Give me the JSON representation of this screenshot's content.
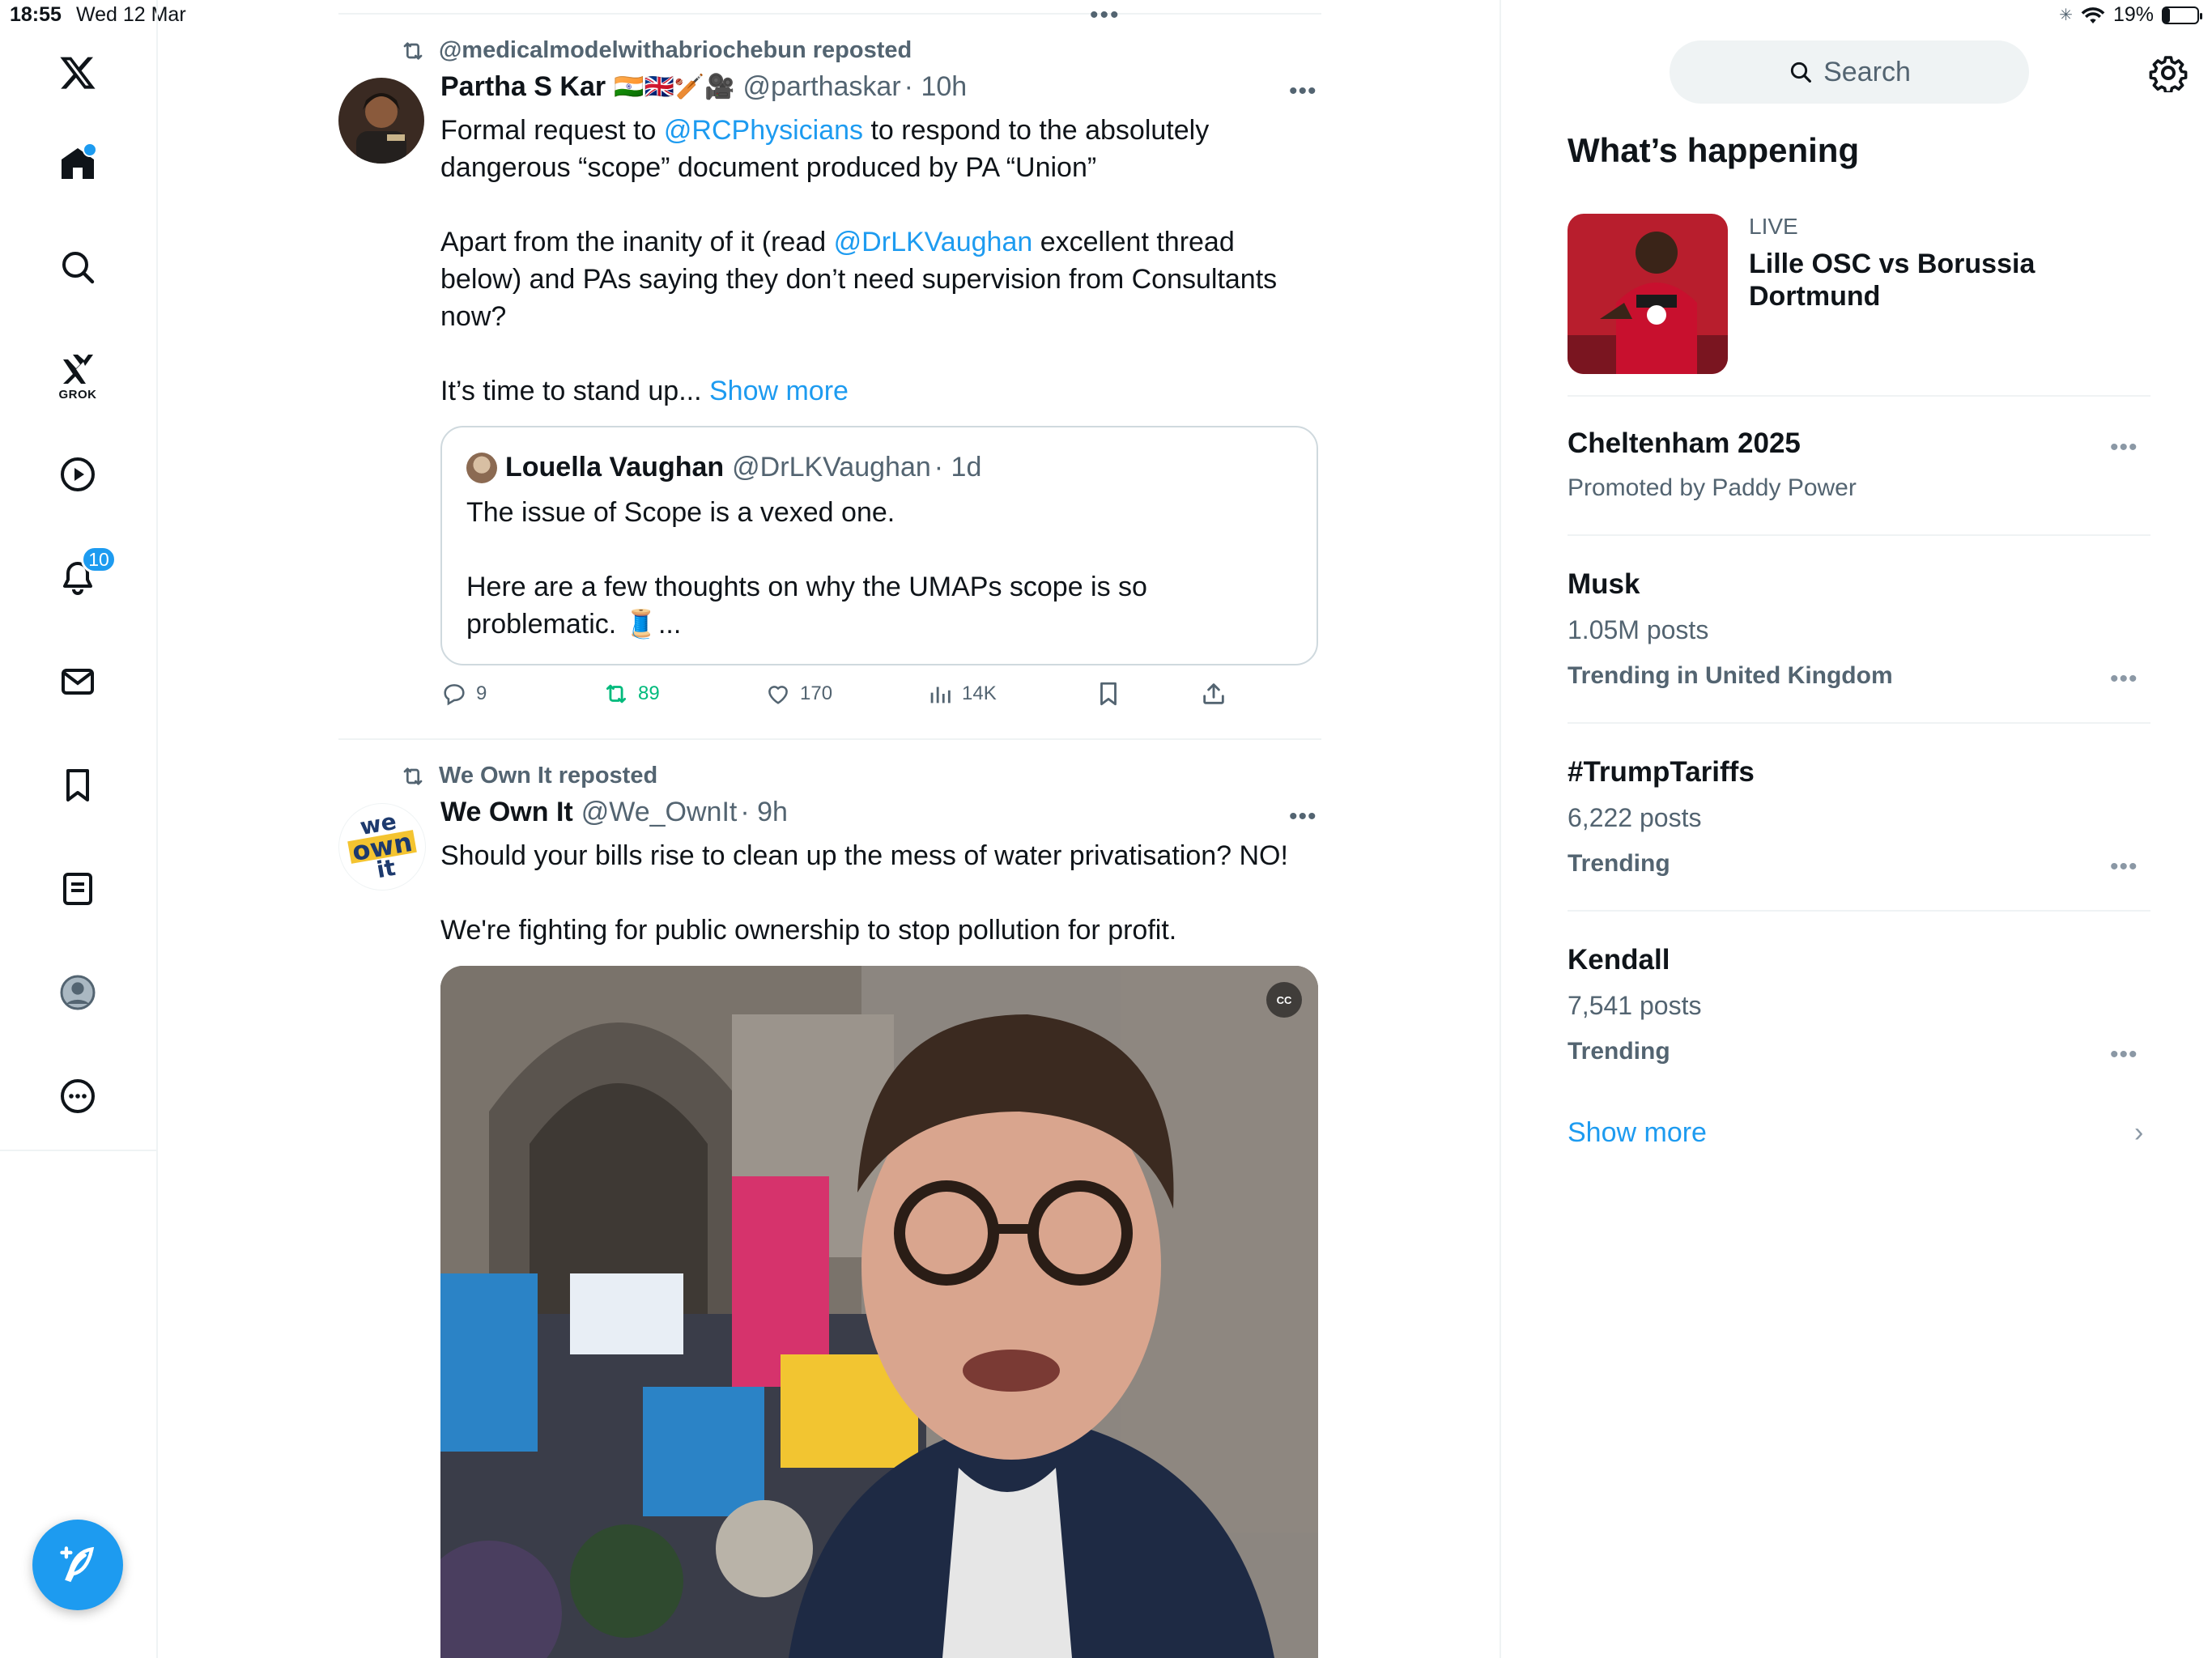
{
  "status_bar": {
    "time": "18:55",
    "date": "Wed 12 Mar",
    "battery": "19%",
    "battery_level": 0.19
  },
  "nav": {
    "grok_label": "GROK",
    "notifications_count": "10"
  },
  "tweets": [
    {
      "reposted_by": "@medicalmodelwithabriochebun reposted",
      "name": "Partha S Kar",
      "emojis": "🇮🇳🇬🇧🏏🎥",
      "handle": "@parthaskar",
      "time": "· 10h",
      "p1_a": "Formal request to ",
      "p1_link": "@RCPhysicians",
      "p1_b": " to respond to the absolutely dangerous “scope” document produced by PA “Union”",
      "p2_a": "Apart from the inanity of it (read ",
      "p2_link": "@DrLKVaughan",
      "p2_b": " excellent thread below) and PAs saying they don’t need supervision from Consultants now?",
      "p3_a": "It’s time to stand up... ",
      "p3_link": "Show more",
      "quote": {
        "name": "Louella Vaughan",
        "handle": "@DrLKVaughan",
        "time": "· 1d",
        "p1": "The issue of Scope is a vexed one.",
        "p2": "Here are a few thoughts on why the UMAPs scope is so problematic. 🧵..."
      },
      "actions": {
        "replies": "9",
        "reposts": "89",
        "likes": "170",
        "views": "14K"
      }
    },
    {
      "reposted_by": "We Own It reposted",
      "name": "We Own It",
      "handle": "@We_OwnIt",
      "time": "· 9h",
      "avatar_text": [
        "we",
        "own",
        "it"
      ],
      "p1": "Should your bills rise to clean up the mess of water privatisation? NO!",
      "p2": "We're fighting for public ownership to stop pollution for profit.",
      "media_cc": "CC"
    }
  ],
  "sidebar": {
    "search_placeholder": "Search",
    "title": "What’s happening",
    "live": {
      "label": "LIVE",
      "title": "Lille OSC vs Borussia Dortmund"
    },
    "trends": [
      {
        "name": "Cheltenham 2025",
        "sub": "Promoted by Paddy Power"
      },
      {
        "name": "Musk",
        "posts": "1.05M posts",
        "context": "Trending in United Kingdom"
      },
      {
        "name": "#TrumpTariffs",
        "posts": "6,222 posts",
        "context": "Trending"
      },
      {
        "name": "Kendall",
        "posts": "7,541 posts",
        "context": "Trending"
      }
    ],
    "show_more": "Show more"
  },
  "colors": {
    "accent": "#1d9bf0",
    "repost_green": "#00ba7c",
    "muted": "#536471"
  }
}
